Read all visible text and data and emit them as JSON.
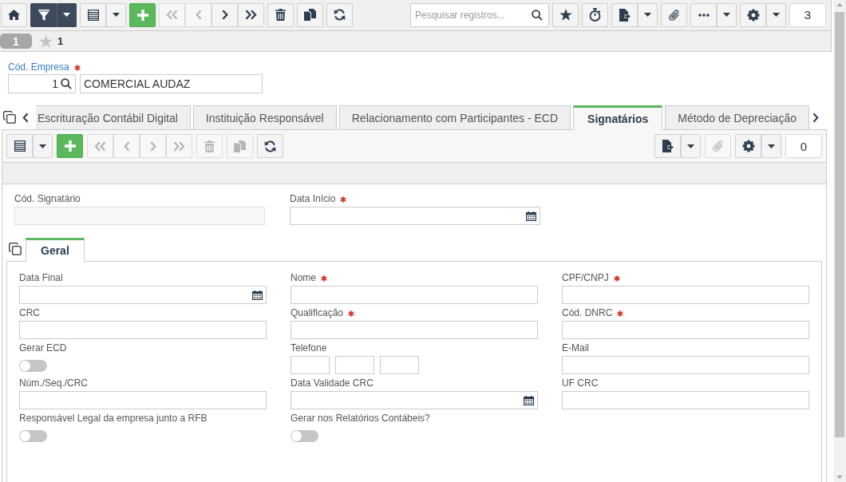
{
  "toolbar": {
    "left": [
      [
        {
          "kind": "home",
          "pressed": false,
          "disabled": false
        }
      ],
      [
        {
          "kind": "filter",
          "pressed": true,
          "disabled": false
        },
        {
          "kind": "caret",
          "pressed": true,
          "disabled": false
        }
      ],
      [
        {
          "kind": "grid",
          "pressed": false,
          "disabled": false
        },
        {
          "kind": "caret",
          "pressed": false,
          "disabled": false
        }
      ],
      [
        {
          "kind": "add",
          "pressed": false,
          "disabled": false
        }
      ],
      [
        {
          "kind": "first",
          "pressed": false,
          "disabled": true
        },
        {
          "kind": "previous",
          "pressed": false,
          "disabled": true
        },
        {
          "kind": "next",
          "pressed": false,
          "disabled": false
        },
        {
          "kind": "last",
          "pressed": false,
          "disabled": false
        }
      ],
      [
        {
          "kind": "delete",
          "pressed": false,
          "disabled": false
        }
      ],
      [
        {
          "kind": "copy",
          "pressed": false,
          "disabled": false
        }
      ],
      [
        {
          "kind": "refresh",
          "pressed": false,
          "disabled": false
        }
      ]
    ],
    "search": {
      "placeholder": "Pesquisar registros..."
    },
    "right": [
      [
        {
          "kind": "star",
          "pressed": false,
          "disabled": false
        }
      ],
      [
        {
          "kind": "timer",
          "pressed": false,
          "disabled": false
        }
      ],
      [
        {
          "kind": "export",
          "pressed": false,
          "disabled": false
        },
        {
          "kind": "caret",
          "pressed": false,
          "disabled": false
        }
      ],
      [
        {
          "kind": "attach",
          "pressed": false,
          "disabled": false
        }
      ],
      [
        {
          "kind": "more",
          "pressed": false,
          "disabled": false
        },
        {
          "kind": "caret",
          "pressed": false,
          "disabled": false
        }
      ],
      [
        {
          "kind": "settings",
          "pressed": false,
          "disabled": false
        },
        {
          "kind": "caret",
          "pressed": false,
          "disabled": false
        }
      ]
    ],
    "counter": "3"
  },
  "record_bar": {
    "record": "1",
    "favorites": "1"
  },
  "company": {
    "label": "Cód. Empresa",
    "required": true,
    "code": "1",
    "name": "COMERCIAL AUDAZ"
  },
  "tabs": [
    {
      "label": "Escrituração Contábil Digital",
      "selected": false
    },
    {
      "label": "Instituição Responsável",
      "selected": false
    },
    {
      "label": "Relacionamento com Participantes - ECD",
      "selected": false
    },
    {
      "label": "Signatários",
      "selected": true
    },
    {
      "label": "Método de Depreciação",
      "selected": false
    }
  ],
  "signatarios": {
    "toolbar": {
      "left": [
        [
          {
            "kind": "grid",
            "disabled": false
          },
          {
            "kind": "caret",
            "disabled": false
          }
        ],
        [
          {
            "kind": "add",
            "disabled": false
          }
        ],
        [
          {
            "kind": "first",
            "disabled": true
          },
          {
            "kind": "previous",
            "disabled": true
          },
          {
            "kind": "next",
            "disabled": true
          },
          {
            "kind": "last",
            "disabled": true
          }
        ],
        [
          {
            "kind": "delete",
            "disabled": true
          }
        ],
        [
          {
            "kind": "copy",
            "disabled": true
          }
        ],
        [
          {
            "kind": "refresh",
            "disabled": false
          }
        ]
      ],
      "right": [
        [
          {
            "kind": "export",
            "disabled": false
          },
          {
            "kind": "caret",
            "disabled": false
          }
        ],
        [
          {
            "kind": "attach",
            "disabled": true
          }
        ],
        [
          {
            "kind": "settings",
            "disabled": false
          },
          {
            "kind": "caret",
            "disabled": false
          }
        ]
      ],
      "counter": "0"
    },
    "fields": [
      {
        "label": "Cód. Signatário",
        "kind": "text",
        "required": false,
        "disabled": true
      },
      {
        "label": "Data Início",
        "kind": "date",
        "required": true,
        "disabled": false
      }
    ],
    "detail_tabs": [
      {
        "label": "Geral",
        "selected": true
      }
    ],
    "geral": {
      "fields": [
        {
          "label": "Data Final",
          "kind": "date",
          "required": false
        },
        {
          "label": "Nome",
          "kind": "text",
          "required": true
        },
        {
          "label": "CPF/CNPJ",
          "kind": "text",
          "required": true
        },
        {
          "label": "CRC",
          "kind": "text",
          "required": false
        },
        {
          "label": "Qualificação",
          "kind": "text",
          "required": true
        },
        {
          "label": "Cód. DNRC",
          "kind": "text",
          "required": true
        },
        {
          "label": "Gerar ECD",
          "kind": "toggle",
          "required": false,
          "on": false
        },
        {
          "label": "Telefone",
          "kind": "phone",
          "required": false
        },
        {
          "label": "E-Mail",
          "kind": "text",
          "required": false
        },
        {
          "label": "Núm./Seq./CRC",
          "kind": "text",
          "required": false
        },
        {
          "label": "Data Validade CRC",
          "kind": "date",
          "required": false
        },
        {
          "label": "UF CRC",
          "kind": "text",
          "required": false
        },
        {
          "label": "Responsável Legal da empresa junto a RFB",
          "kind": "toggle",
          "required": false,
          "on": false
        },
        {
          "label": "Gerar nos Relatórios Contábeis?",
          "kind": "toggle",
          "required": false,
          "on": false
        }
      ]
    }
  }
}
